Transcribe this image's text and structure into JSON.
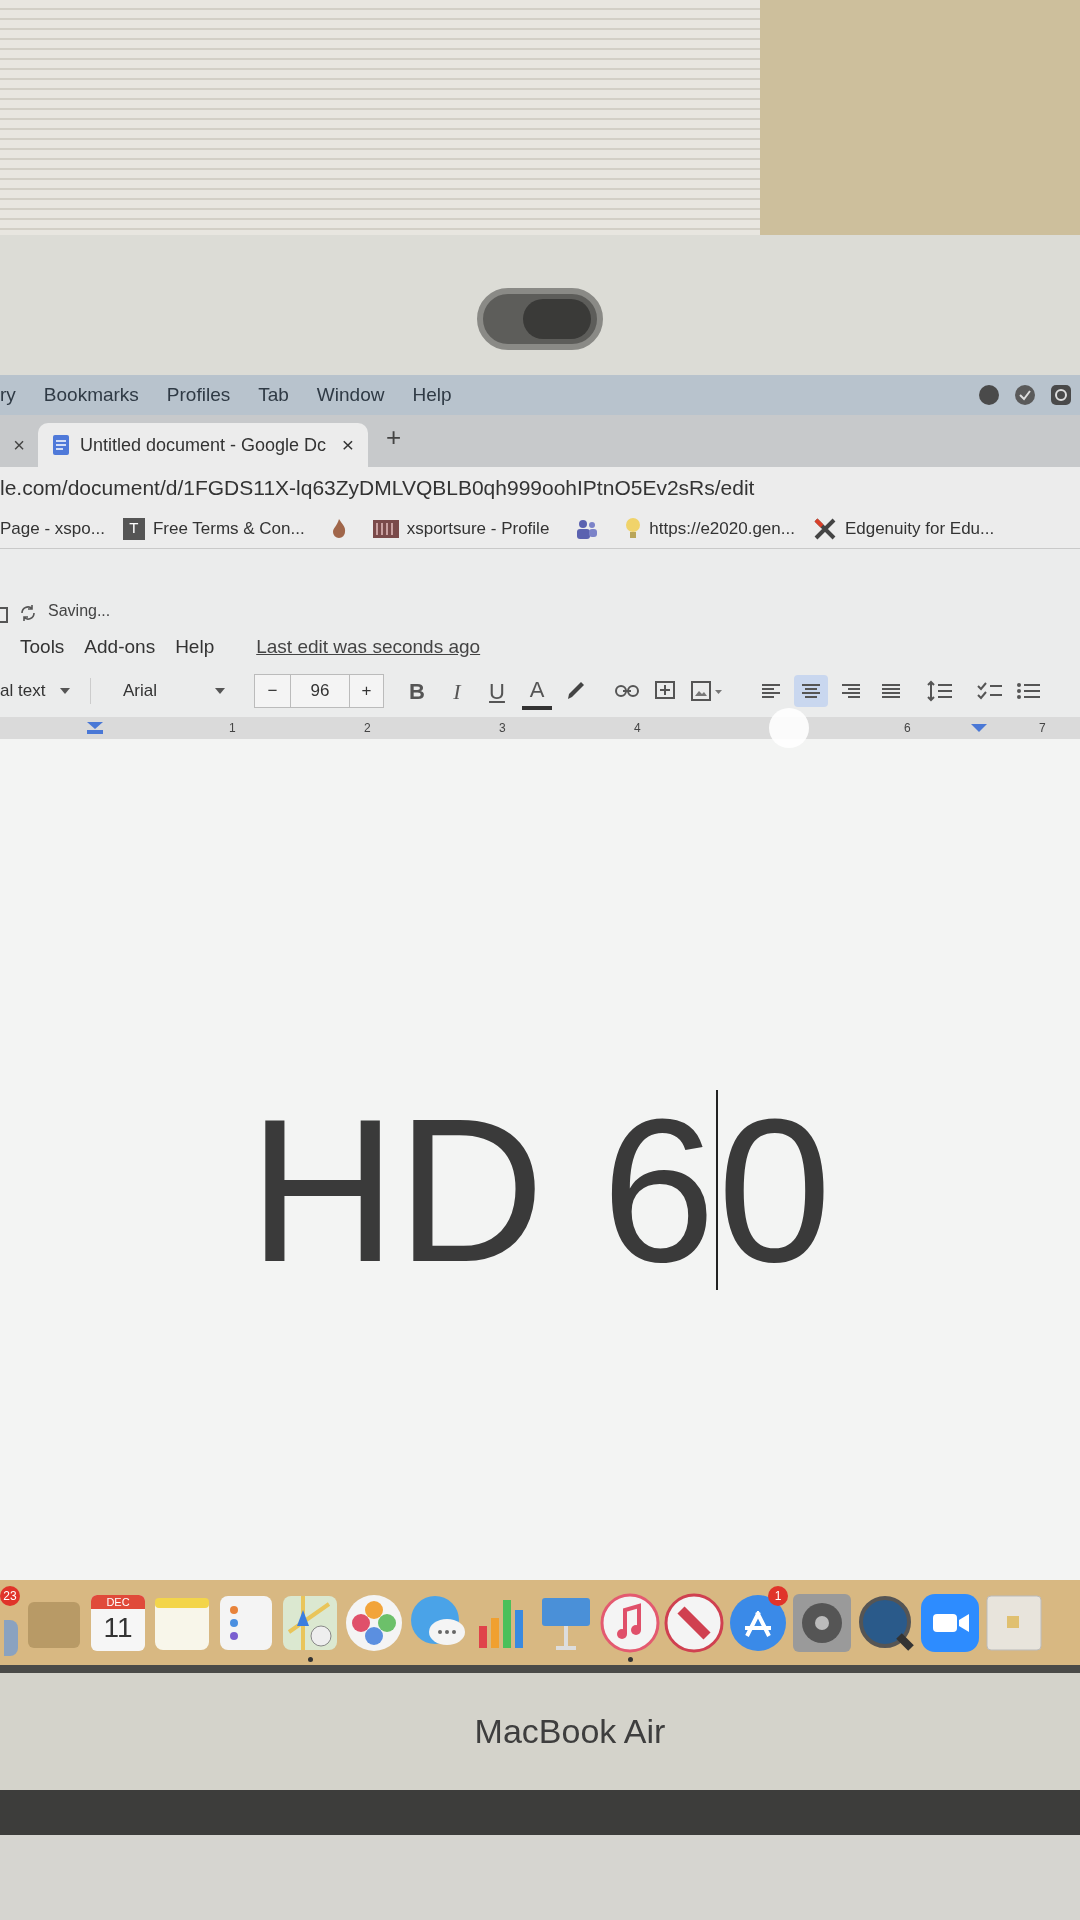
{
  "menu_bar": {
    "items": [
      "ry",
      "Bookmarks",
      "Profiles",
      "Tab",
      "Window",
      "Help"
    ]
  },
  "tab_strip": {
    "partial_tab_close": "×",
    "tabs": [
      {
        "title": "Untitled document - Google Dc",
        "close": "×",
        "selected": true
      }
    ],
    "new_tab": "+"
  },
  "address_bar": {
    "url": "le.com/document/d/1FGDS11X-lq63ZyDMLVQBLB0qh999oohIPtnO5Ev2sRs/edit"
  },
  "bookmarks": [
    {
      "kind": "text",
      "label": "Page - xspo..."
    },
    {
      "kind": "tile",
      "icon_letter": "T",
      "label": "Free Terms & Con..."
    },
    {
      "kind": "flame"
    },
    {
      "kind": "stripes",
      "label": "xsportsure - Profile"
    },
    {
      "kind": "people"
    },
    {
      "kind": "bulb",
      "label": "https://e2020.gen..."
    },
    {
      "kind": "cross",
      "label": "Edgenuity for Edu..."
    }
  ],
  "docs_header": {
    "status": "Saving...",
    "menus": [
      "Tools",
      "Add-ons",
      "Help"
    ],
    "last_edit": "Last edit was seconds ago"
  },
  "toolbar": {
    "style": "al text",
    "font": "Arial",
    "size_minus": "−",
    "font_size": "96",
    "size_plus": "+",
    "bold": "B",
    "italic": "I",
    "underline": "U",
    "text_color": "A",
    "align": [
      {
        "kind": "left",
        "selected": false
      },
      {
        "kind": "center",
        "selected": true
      },
      {
        "kind": "right",
        "selected": false
      },
      {
        "kind": "justify",
        "selected": false
      }
    ]
  },
  "ruler": {
    "marks": [
      {
        "kind": "number",
        "label": "1"
      },
      {
        "kind": "number",
        "label": "2"
      },
      {
        "kind": "number",
        "label": "3"
      },
      {
        "kind": "number",
        "label": "4"
      },
      {
        "kind": "glare"
      },
      {
        "kind": "number",
        "label": "6"
      },
      {
        "kind": "number",
        "label": "7"
      }
    ]
  },
  "document": {
    "text_before_cursor": "HD 6",
    "text_after_cursor": "0"
  },
  "dock": [
    {
      "kind": "partial",
      "badge": "23",
      "running": false
    },
    {
      "kind": "folder",
      "running": false
    },
    {
      "kind": "calendar",
      "month": "DEC",
      "day": "11",
      "running": false
    },
    {
      "kind": "notes",
      "running": false
    },
    {
      "kind": "reminders",
      "running": false
    },
    {
      "kind": "maps",
      "running": true
    },
    {
      "kind": "photos",
      "running": false
    },
    {
      "kind": "messages",
      "running": false
    },
    {
      "kind": "numbers",
      "running": false
    },
    {
      "kind": "keynote",
      "running": false
    },
    {
      "kind": "music",
      "running": true
    },
    {
      "kind": "news",
      "running": false
    },
    {
      "kind": "appstore",
      "badge": "1",
      "running": false
    },
    {
      "kind": "settings",
      "running": false
    },
    {
      "kind": "quicktime",
      "running": false
    },
    {
      "kind": "zoom",
      "running": false
    },
    {
      "kind": "preview",
      "running": false
    }
  ],
  "bezel_label": "MacBook Air",
  "webcam_cover": {
    "closed": true
  }
}
